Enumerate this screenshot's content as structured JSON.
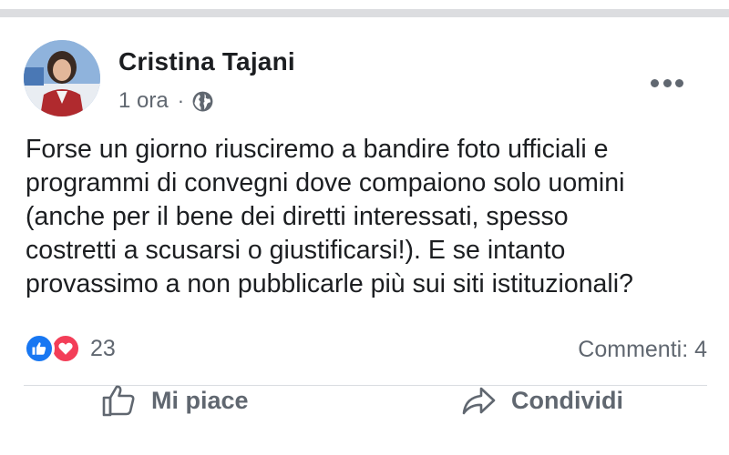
{
  "post": {
    "author": "Cristina Tajani",
    "time": "1 ora",
    "separator": "·",
    "privacy_icon": "globe-icon",
    "more_icon": "more-options-icon",
    "body_lines": [
      "Forse un giorno riusciremo a bandire foto ufficiali e",
      "programmi di convegni dove compaiono solo uomini",
      "(anche per il bene dei diretti interessati, spesso",
      "costretti a scusarsi o giustificarsi!). E se intanto",
      "provassimo a non pubblicarle più sui siti istituzionali?"
    ],
    "reactions": {
      "types": [
        "like",
        "love"
      ],
      "count": "23"
    },
    "comments_label": "Commenti: 4"
  },
  "actions": {
    "like_label": "Mi piace",
    "share_label": "Condividi"
  },
  "colors": {
    "like_blue": "#1877f2",
    "love_red": "#f33e58",
    "secondary_text": "#606770"
  }
}
